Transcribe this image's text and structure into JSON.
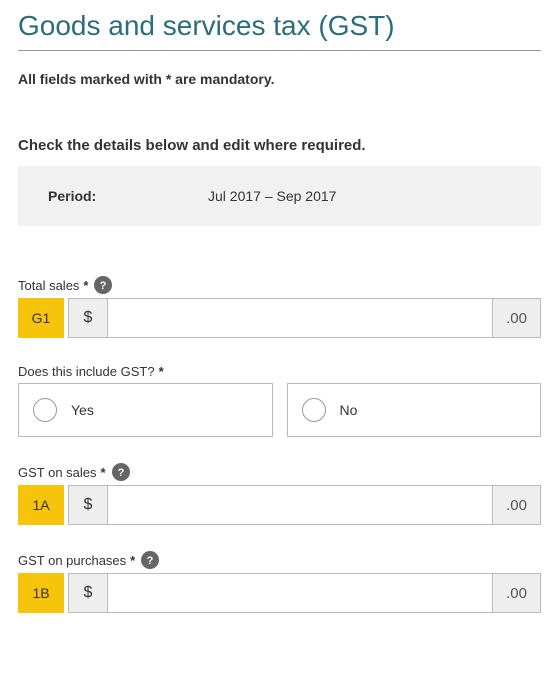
{
  "title": "Goods and services tax (GST)",
  "mandatory_note": "All fields marked with * are mandatory.",
  "check_details": "Check the details below and edit where required.",
  "period": {
    "label": "Period:",
    "value": "Jul 2017 – Sep 2017"
  },
  "fields": {
    "total_sales": {
      "label": "Total sales",
      "code": "G1",
      "prefix": "$",
      "suffix": ".00",
      "value": ""
    },
    "include_gst": {
      "label": "Does this include GST?",
      "yes": "Yes",
      "no": "No"
    },
    "gst_on_sales": {
      "label": "GST on sales",
      "code": "1A",
      "prefix": "$",
      "suffix": ".00",
      "value": ""
    },
    "gst_on_purchases": {
      "label": "GST on purchases",
      "code": "1B",
      "prefix": "$",
      "suffix": ".00",
      "value": ""
    }
  },
  "asterisk": "*"
}
